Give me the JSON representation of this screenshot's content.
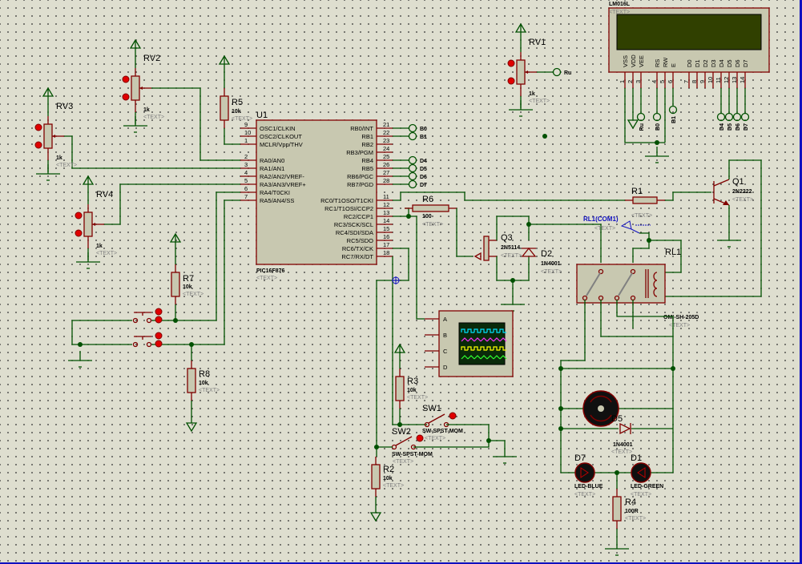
{
  "canvas": {
    "background": "#dedecf",
    "wire_color": "#005000",
    "component_color": "#800000",
    "component_fill": "#c8c8b0",
    "lcd_screen": "#304000"
  },
  "u1": {
    "ref": "U1",
    "part": "PIC16F876",
    "text": "<TEXT>",
    "left_pins": [
      {
        "num": "9",
        "name": "OSC1/CLKIN"
      },
      {
        "num": "10",
        "name": "OSC2/CLKOUT"
      },
      {
        "num": "1",
        "name": "MCLR/Vpp/THV"
      },
      {
        "num": "2",
        "name": "RA0/AN0"
      },
      {
        "num": "3",
        "name": "RA1/AN1"
      },
      {
        "num": "4",
        "name": "RA2/AN2/VREF-"
      },
      {
        "num": "5",
        "name": "RA3/AN3/VREF+"
      },
      {
        "num": "6",
        "name": "RA4/T0CKI"
      },
      {
        "num": "7",
        "name": "RA5/AN4/SS"
      }
    ],
    "right_pins": [
      {
        "num": "21",
        "name": "RB0/INT"
      },
      {
        "num": "22",
        "name": "RB1"
      },
      {
        "num": "23",
        "name": "RB2"
      },
      {
        "num": "24",
        "name": "RB3/PGM"
      },
      {
        "num": "25",
        "name": "RB4"
      },
      {
        "num": "26",
        "name": "RB5"
      },
      {
        "num": "27",
        "name": "RB6/PGC"
      },
      {
        "num": "28",
        "name": "RB7/PGD"
      },
      {
        "num": "11",
        "name": "RC0/T1OSO/T1CKI"
      },
      {
        "num": "12",
        "name": "RC1/T1OSI/CCP2"
      },
      {
        "num": "13",
        "name": "RC2/CCP1"
      },
      {
        "num": "14",
        "name": "RC3/SCK/SCL"
      },
      {
        "num": "15",
        "name": "RC4/SDI/SDA"
      },
      {
        "num": "16",
        "name": "RC5/SDO"
      },
      {
        "num": "17",
        "name": "RC6/TX/CK"
      },
      {
        "num": "18",
        "name": "RC7/RX/DT"
      }
    ],
    "terminals": [
      "B0",
      "B1",
      "D4",
      "D5",
      "D6",
      "D7"
    ]
  },
  "lcd": {
    "part": "LM016L",
    "text": "<TEXT>",
    "pins": [
      {
        "name": "VSS",
        "num": "1"
      },
      {
        "name": "VDD",
        "num": "2"
      },
      {
        "name": "VEE",
        "num": "3"
      },
      {
        "name": "RS",
        "num": "4"
      },
      {
        "name": "RW",
        "num": "5"
      },
      {
        "name": "E",
        "num": "6"
      },
      {
        "name": "D0",
        "num": "7"
      },
      {
        "name": "D1",
        "num": "8"
      },
      {
        "name": "D2",
        "num": "9"
      },
      {
        "name": "D3",
        "num": "10"
      },
      {
        "name": "D4",
        "num": "11"
      },
      {
        "name": "D5",
        "num": "12"
      },
      {
        "name": "D6",
        "num": "13"
      },
      {
        "name": "D7",
        "num": "14"
      }
    ],
    "terminals": {
      "vee": "Ru",
      "rs": "B0",
      "e": "B1",
      "d4": "D4",
      "d5": "D5",
      "d6": "D6",
      "d7": "D7"
    }
  },
  "rv1": {
    "ref": "RV1",
    "value": "1k",
    "text": "<TEXT>",
    "terminal": "Ru"
  },
  "rv2": {
    "ref": "RV2",
    "value": "1k",
    "text": "<TEXT>"
  },
  "rv3": {
    "ref": "RV3",
    "value": "1k",
    "text": "<TEXT>"
  },
  "rv4": {
    "ref": "RV4",
    "value": "1k",
    "text": "<TEXT>"
  },
  "r1": {
    "ref": "R1",
    "text": "<TEXT>"
  },
  "r2": {
    "ref": "R2",
    "value": "10k",
    "text": "<TEXT>"
  },
  "r3": {
    "ref": "R3",
    "value": "10k",
    "text": "<TEXT>"
  },
  "r4": {
    "ref": "R4",
    "value": "100R",
    "text": "<TEXT>"
  },
  "r5": {
    "ref": "R5",
    "value": "10k",
    "text": "<TEXT>"
  },
  "r6": {
    "ref": "R6",
    "value": "100",
    "text": "<TEXT>"
  },
  "r7": {
    "ref": "R7",
    "value": "10k",
    "text": "<TEXT>"
  },
  "r8": {
    "ref": "R8",
    "value": "10k",
    "text": "<TEXT>"
  },
  "q1": {
    "ref": "Q1",
    "part": "2N2222",
    "text": "<TEXT>"
  },
  "q3": {
    "ref": "Q3",
    "part": "2N5114",
    "text": "<TEXT>"
  },
  "d2": {
    "ref": "D2",
    "part": "1N4001",
    "text": "<TEXT>"
  },
  "d5": {
    "ref": "D5",
    "part": "1N4001",
    "text": "<TEXT>"
  },
  "d7": {
    "ref": "D7",
    "part": "LED-BLUE",
    "text": "<TEXT>"
  },
  "d1": {
    "ref": "D1",
    "part": "LED-GREEN",
    "text": "<TEXT>"
  },
  "rl1": {
    "ref": "RL1",
    "part": "OMI-SH-205D",
    "text": "<TEXT>"
  },
  "probe": {
    "label": "RL1(COM1)",
    "text": "<TEXT>"
  },
  "sw1": {
    "ref": "SW1",
    "part": "SW-SPST-MOM",
    "text": "<TEXT>"
  },
  "sw2": {
    "ref": "SW2",
    "part": "SW-SPST-MOM",
    "text": "<TEXT>"
  },
  "scope": {
    "channels": [
      "A",
      "B",
      "C",
      "D"
    ],
    "trace_colors": [
      "#00e0ff",
      "#ff30ff",
      "#ffff00",
      "#30ff30"
    ]
  }
}
